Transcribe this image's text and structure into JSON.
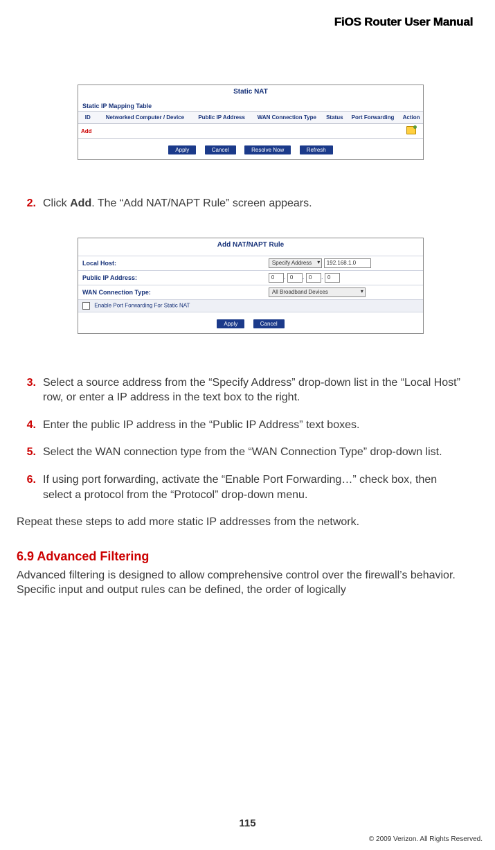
{
  "header": {
    "title": "FiOS Router User Manual"
  },
  "screenshot1": {
    "title": "Static NAT",
    "subtitle": "Static IP Mapping Table",
    "columns": [
      "ID",
      "Networked Computer / Device",
      "Public IP Address",
      "WAN Connection Type",
      "Status",
      "Port Forwarding",
      "Action"
    ],
    "add_label": "Add",
    "buttons": [
      "Apply",
      "Cancel",
      "Resolve Now",
      "Refresh"
    ]
  },
  "step2": {
    "num": "2.",
    "text_pre": "Click ",
    "bold": "Add",
    "text_post": ". The “Add NAT/NAPT Rule” screen appears."
  },
  "screenshot2": {
    "title": "Add NAT/NAPT Rule",
    "rows": {
      "local_host_label": "Local Host:",
      "local_host_select": "Specify Address",
      "local_host_value": "192.168.1.0",
      "public_ip_label": "Public IP Address:",
      "public_ip_values": [
        "0",
        "0",
        "0",
        "0"
      ],
      "wan_label": "WAN Connection Type:",
      "wan_value": "All Broadband Devices",
      "check_label": "Enable Port Forwarding For Static NAT"
    },
    "buttons": [
      "Apply",
      "Cancel"
    ]
  },
  "step3": {
    "num": "3.",
    "text": "Select a source address from the “Specify Address” drop-down list in the “Local Host” row, or enter a IP address in the text box to the right."
  },
  "step4": {
    "num": "4.",
    "text": "Enter the public IP address in the “Public IP Address” text boxes."
  },
  "step5": {
    "num": "5.",
    "text": "Select the WAN connection type from the “WAN Connection Type” drop-down list."
  },
  "step6": {
    "num": "6.",
    "text": "If using port forwarding, activate the “Enable Port Forwarding…” check box, then select a protocol from the “Protocol” drop-down menu."
  },
  "after_steps": "Repeat these steps to add more static IP addresses from the network.",
  "section": {
    "heading": "6.9  Advanced Filtering",
    "body": "Advanced filtering is designed to allow comprehensive control over the firewall’s behavior. Specific input and output rules can be defined, the order of logically"
  },
  "page_number": "115",
  "copyright": "© 2009 Verizon. All Rights Reserved."
}
